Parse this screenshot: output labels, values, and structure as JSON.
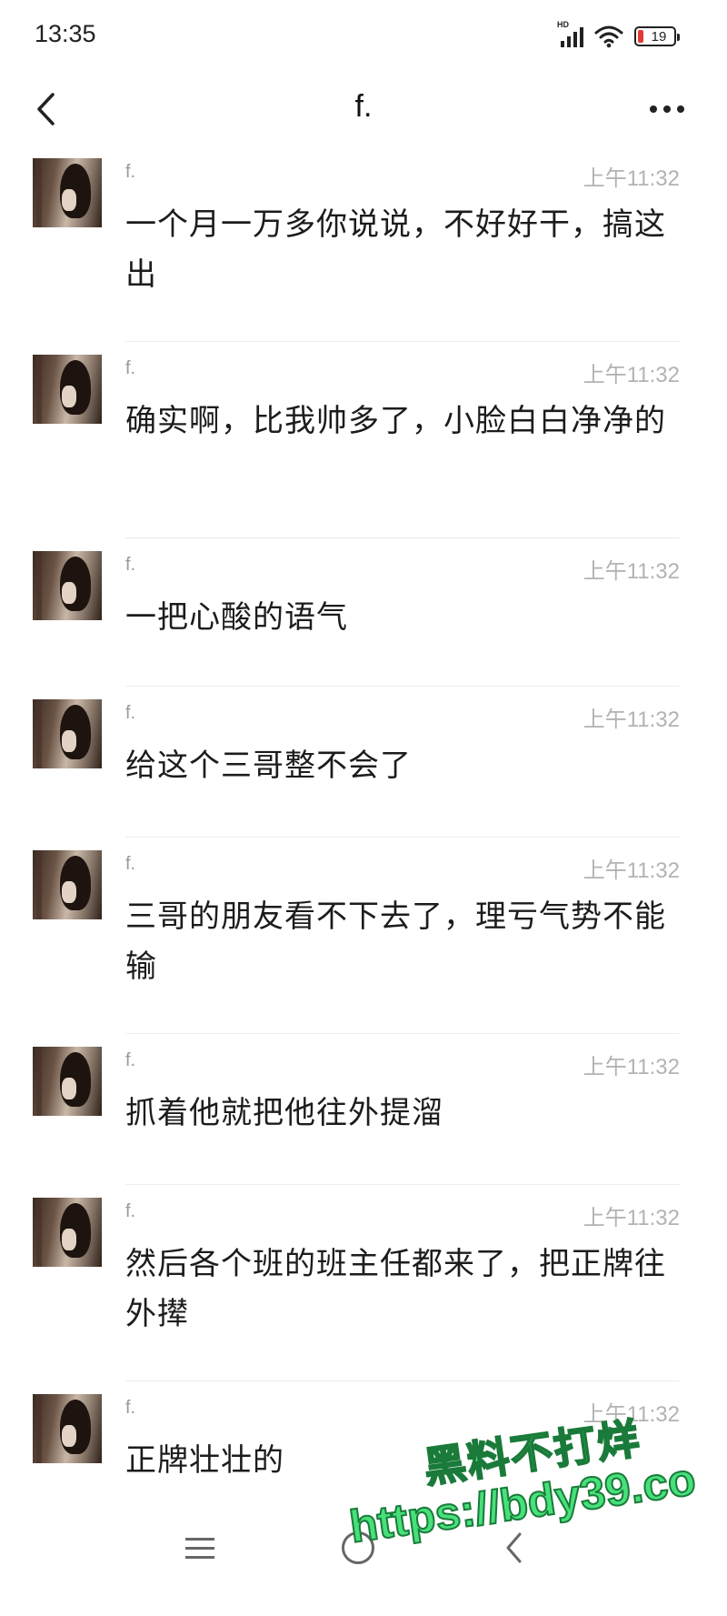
{
  "status_bar": {
    "time": "13:35",
    "network_label": "HD",
    "battery_level": "19",
    "icons": [
      "signal-icon",
      "wifi-icon",
      "battery-icon"
    ]
  },
  "header": {
    "title": "f.",
    "back_icon": "chevron-left-icon",
    "more_icon": "more-horizontal-icon"
  },
  "messages": [
    {
      "sender": "f.",
      "time": "上午11:32",
      "text": "一个月一万多你说说，不好好干，搞这出"
    },
    {
      "sender": "f.",
      "time": "上午11:32",
      "text": "确实啊，比我帅多了，小脸白白净净的"
    },
    {
      "sender": "f.",
      "time": "上午11:32",
      "text": "一把心酸的语气"
    },
    {
      "sender": "f.",
      "time": "上午11:32",
      "text": "给这个三哥整不会了"
    },
    {
      "sender": "f.",
      "time": "上午11:32",
      "text": "三哥的朋友看不下去了，理亏气势不能输"
    },
    {
      "sender": "f.",
      "time": "上午11:32",
      "text": "抓着他就把他往外提溜"
    },
    {
      "sender": "f.",
      "time": "上午11:32",
      "text": "然后各个班的班主任都来了，把正牌往外撵"
    },
    {
      "sender": "f.",
      "time": "上午11:32",
      "text": "正牌壮壮的"
    }
  ],
  "bottom_nav": {
    "icons": [
      "menu-icon",
      "home-icon",
      "back-icon"
    ]
  },
  "watermark": {
    "line1": "黑料不打烊",
    "line2": "https://bdy39.co"
  },
  "colors": {
    "background": "#ffffff",
    "text": "#1c1c1c",
    "meta": "#b3b3b3",
    "battery_low": "#e53935",
    "watermark": "#47e07a"
  }
}
